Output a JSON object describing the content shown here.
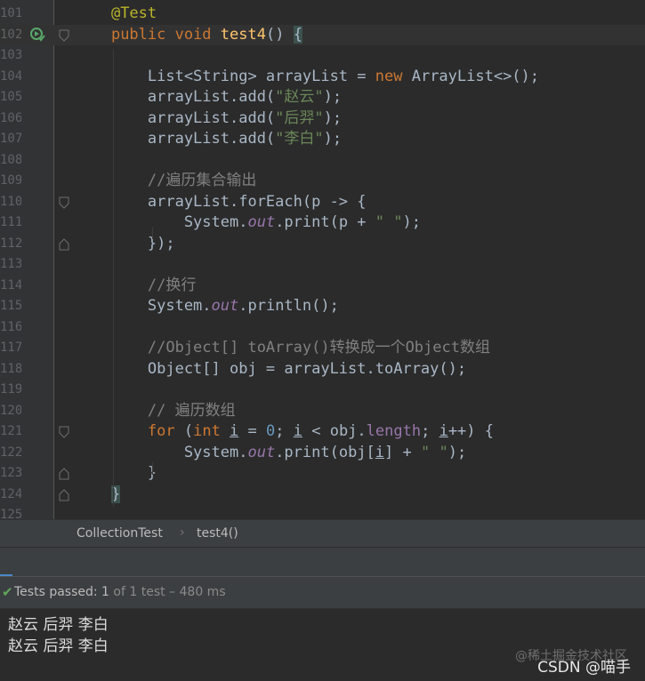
{
  "editor": {
    "lines": [
      {
        "num": "101",
        "segs": [
          {
            "t": "    ",
            "c": ""
          },
          {
            "t": "@Test",
            "c": "an"
          }
        ]
      },
      {
        "num": "102",
        "current": true,
        "segs": [
          {
            "t": "    ",
            "c": ""
          },
          {
            "t": "public void ",
            "c": "kw"
          },
          {
            "t": "test4",
            "c": "fn"
          },
          {
            "t": "() ",
            "c": ""
          },
          {
            "t": "{",
            "c": "br"
          }
        ]
      },
      {
        "num": "103",
        "segs": []
      },
      {
        "num": "104",
        "segs": [
          {
            "t": "        List<String> arrayList = ",
            "c": ""
          },
          {
            "t": "new ",
            "c": "kw"
          },
          {
            "t": "ArrayList<>();",
            "c": ""
          }
        ]
      },
      {
        "num": "105",
        "segs": [
          {
            "t": "        arrayList.add(",
            "c": ""
          },
          {
            "t": "\"赵云\"",
            "c": "str"
          },
          {
            "t": ");",
            "c": ""
          }
        ]
      },
      {
        "num": "106",
        "segs": [
          {
            "t": "        arrayList.add(",
            "c": ""
          },
          {
            "t": "\"后羿\"",
            "c": "str"
          },
          {
            "t": ");",
            "c": ""
          }
        ]
      },
      {
        "num": "107",
        "segs": [
          {
            "t": "        arrayList.add(",
            "c": ""
          },
          {
            "t": "\"李白\"",
            "c": "str"
          },
          {
            "t": ");",
            "c": ""
          }
        ]
      },
      {
        "num": "108",
        "segs": []
      },
      {
        "num": "109",
        "segs": [
          {
            "t": "        //遍历集合输出",
            "c": "cm"
          }
        ]
      },
      {
        "num": "110",
        "segs": [
          {
            "t": "        arrayList.forEach(p -> {",
            "c": ""
          }
        ]
      },
      {
        "num": "111",
        "segs": [
          {
            "t": "            System.",
            "c": ""
          },
          {
            "t": "out",
            "c": "it"
          },
          {
            "t": ".print(p + ",
            "c": ""
          },
          {
            "t": "\" \"",
            "c": "str"
          },
          {
            "t": ");",
            "c": ""
          }
        ]
      },
      {
        "num": "112",
        "segs": [
          {
            "t": "        });",
            "c": ""
          }
        ]
      },
      {
        "num": "113",
        "segs": []
      },
      {
        "num": "114",
        "segs": [
          {
            "t": "        //换行",
            "c": "cm"
          }
        ]
      },
      {
        "num": "115",
        "segs": [
          {
            "t": "        System.",
            "c": ""
          },
          {
            "t": "out",
            "c": "it"
          },
          {
            "t": ".println();",
            "c": ""
          }
        ]
      },
      {
        "num": "116",
        "segs": []
      },
      {
        "num": "117",
        "segs": [
          {
            "t": "        //Object[] toArray()转换成一个Object数组",
            "c": "cm"
          }
        ]
      },
      {
        "num": "118",
        "segs": [
          {
            "t": "        Object[] obj = arrayList.toArray();",
            "c": ""
          }
        ]
      },
      {
        "num": "119",
        "segs": []
      },
      {
        "num": "120",
        "segs": [
          {
            "t": "        // 遍历数组",
            "c": "cm"
          }
        ]
      },
      {
        "num": "121",
        "segs": [
          {
            "t": "        ",
            "c": ""
          },
          {
            "t": "for ",
            "c": "kw"
          },
          {
            "t": "(",
            "c": ""
          },
          {
            "t": "int ",
            "c": "kw"
          },
          {
            "t": "i",
            "c": "ul"
          },
          {
            "t": " = ",
            "c": ""
          },
          {
            "t": "0",
            "c": "num"
          },
          {
            "t": "; ",
            "c": ""
          },
          {
            "t": "i",
            "c": "ul"
          },
          {
            "t": " < obj.",
            "c": ""
          },
          {
            "t": "length",
            "c": "fd"
          },
          {
            "t": "; ",
            "c": ""
          },
          {
            "t": "i",
            "c": "ul"
          },
          {
            "t": "++) {",
            "c": ""
          }
        ]
      },
      {
        "num": "122",
        "segs": [
          {
            "t": "            System.",
            "c": ""
          },
          {
            "t": "out",
            "c": "it"
          },
          {
            "t": ".print(obj[",
            "c": ""
          },
          {
            "t": "i",
            "c": "ul"
          },
          {
            "t": "] + ",
            "c": ""
          },
          {
            "t": "\" \"",
            "c": "str"
          },
          {
            "t": ");",
            "c": ""
          }
        ]
      },
      {
        "num": "123",
        "segs": [
          {
            "t": "        }",
            "c": ""
          }
        ]
      },
      {
        "num": "124",
        "segs": [
          {
            "t": "    ",
            "c": ""
          },
          {
            "t": "}",
            "c": "br"
          }
        ]
      },
      {
        "num": "125",
        "segs": []
      }
    ]
  },
  "breadcrumbs": {
    "class_name": "CollectionTest",
    "separator": "›",
    "method_name": "test4()"
  },
  "status": {
    "passed_label": "Tests passed:",
    "passed_count": "1",
    "total_text": "of 1 test – 480 ms"
  },
  "console": {
    "line1": "赵云  后羿  李白",
    "line2": "赵云  后羿  李白"
  },
  "watermark": {
    "line1": "@稀土掘金技术社区",
    "line2": "CSDN @喵手"
  },
  "icons": {
    "run": "run-test-icon",
    "check": "check-icon"
  }
}
